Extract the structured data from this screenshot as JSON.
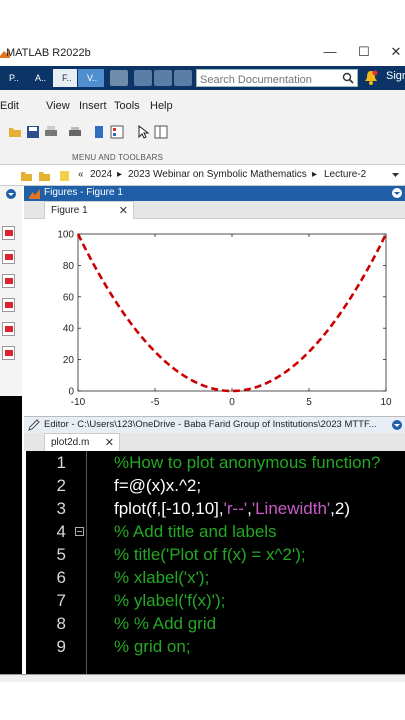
{
  "app": {
    "title": "MATLAB R2022b",
    "min": "—",
    "max": "☐",
    "close": "✕"
  },
  "toolstrip": {
    "tabs": [
      "P..",
      "A..",
      "F..",
      "V.."
    ],
    "search_placeholder": "Search Documentation",
    "sign_in": "Sign"
  },
  "menu": [
    "Edit",
    "View",
    "Insert",
    "Tools",
    "Help"
  ],
  "toolbar": {
    "caption": "MENU AND TOOLBARS"
  },
  "address": {
    "prefix": "«",
    "segments": [
      "2024",
      "2023 Webinar on Symbolic Mathematics",
      "Lecture-2"
    ],
    "sep": "▸"
  },
  "figures": {
    "window_title": "Figures - Figure 1",
    "tab_label": "Figure 1",
    "tab_close": "✕"
  },
  "chart_data": {
    "type": "line",
    "function": "x.^2",
    "xlim": [
      -10,
      10
    ],
    "ylim": [
      0,
      100
    ],
    "xticks": [
      -10,
      -5,
      0,
      5,
      10
    ],
    "yticks": [
      0,
      20,
      40,
      60,
      80,
      100
    ],
    "series": [
      {
        "line_color": "#cc0000",
        "line_style": "dashed",
        "line_width": 2,
        "x": [
          -10,
          -9,
          -8,
          -7,
          -6,
          -5,
          -4,
          -3,
          -2,
          -1,
          0,
          1,
          2,
          3,
          4,
          5,
          6,
          7,
          8,
          9,
          10
        ],
        "y": [
          100,
          81,
          64,
          49,
          36,
          25,
          16,
          9,
          4,
          1,
          0,
          1,
          4,
          9,
          16,
          25,
          36,
          49,
          64,
          81,
          100
        ]
      }
    ],
    "title": "",
    "xlabel": "",
    "ylabel": "",
    "grid": false
  },
  "editor": {
    "window_title": "Editor - C:\\Users\\123\\OneDrive - Baba Farid Group of Institutions\\2023 MTTF...",
    "tab_label": "plot2d.m",
    "tab_close": "✕",
    "lines": [
      {
        "n": "1",
        "parts": [
          [
            "cm",
            "%How to plot anonymous function?"
          ]
        ]
      },
      {
        "n": "2",
        "parts": [
          [
            "wh",
            "f=@(x)x.^2;"
          ]
        ]
      },
      {
        "n": "3",
        "parts": [
          [
            "wh",
            "fplot(f,[-10,10],"
          ],
          [
            "st",
            "'r--'"
          ],
          [
            "wh",
            ","
          ],
          [
            "st",
            "'Linewidth'"
          ],
          [
            "wh",
            ",2)"
          ]
        ]
      },
      {
        "n": "4",
        "parts": [
          [
            "cm",
            "% Add title and labels"
          ]
        ]
      },
      {
        "n": "5",
        "parts": [
          [
            "cm",
            "% title('Plot of f(x) = x^2');"
          ]
        ]
      },
      {
        "n": "6",
        "parts": [
          [
            "cm",
            "% xlabel('x');"
          ]
        ]
      },
      {
        "n": "7",
        "parts": [
          [
            "cm",
            "% ylabel('f(x)');"
          ]
        ]
      },
      {
        "n": "8",
        "parts": [
          [
            "cm",
            "% % Add grid"
          ]
        ]
      },
      {
        "n": "9",
        "parts": [
          [
            "cm",
            "% grid on;"
          ]
        ]
      }
    ]
  }
}
